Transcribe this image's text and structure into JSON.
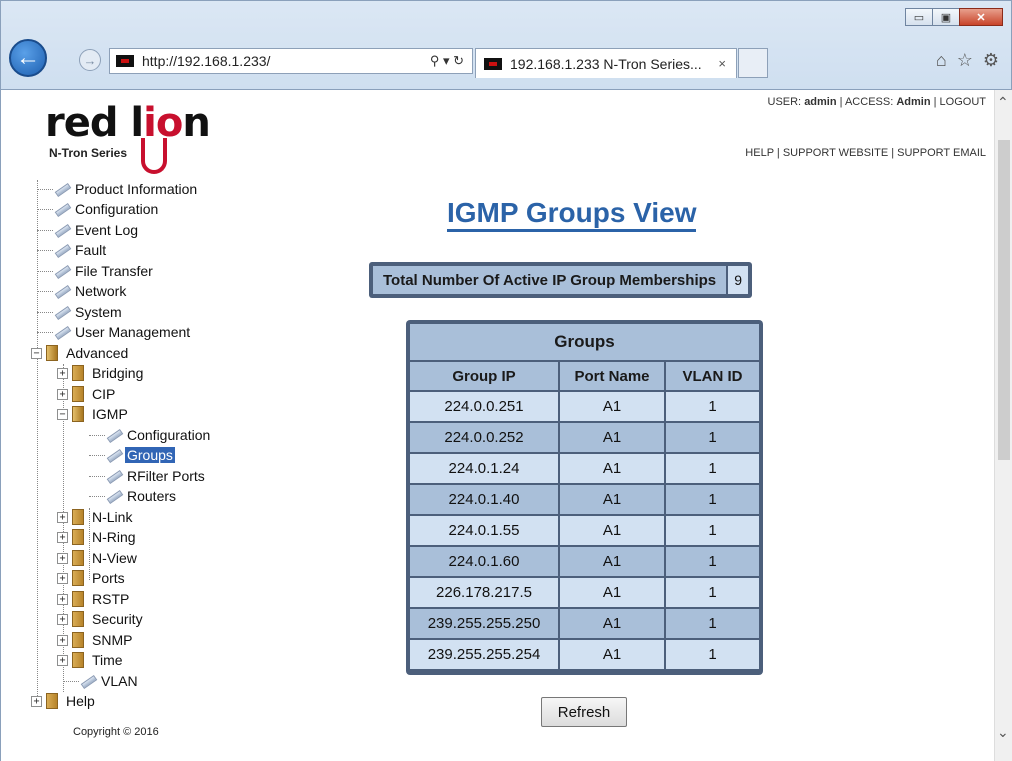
{
  "browser": {
    "url": "http://192.168.1.233/",
    "tab_title": "192.168.1.233 N-Tron Series...",
    "tab_close": "×",
    "back_glyph": "←",
    "forward_glyph": "→",
    "addr_icons": "⚲ ▾ ↻",
    "tools": {
      "home": "⌂",
      "favorites": "☆",
      "settings": "⚙"
    },
    "window": {
      "minimize": "▭",
      "maximize": "▣",
      "close": "✕"
    }
  },
  "header": {
    "logo_text_1": "red l",
    "logo_text_2": "io",
    "logo_text_3": "n",
    "logo_subtitle": "N-Tron Series",
    "user_label": "USER:",
    "user": "admin",
    "access_label": "ACCESS:",
    "access": "Admin",
    "logout": "LOGOUT",
    "help": "HELP",
    "support_website": "SUPPORT WEBSITE",
    "support_email": "SUPPORT EMAIL",
    "sep": "|"
  },
  "tree": {
    "product_information": "Product Information",
    "configuration": "Configuration",
    "event_log": "Event Log",
    "fault": "Fault",
    "file_transfer": "File Transfer",
    "network": "Network",
    "system": "System",
    "user_management": "User Management",
    "advanced": "Advanced",
    "bridging": "Bridging",
    "cip": "CIP",
    "igmp": "IGMP",
    "igmp_configuration": "Configuration",
    "igmp_groups": "Groups",
    "igmp_rfilter": "RFilter Ports",
    "igmp_routers": "Routers",
    "nlink": "N-Link",
    "nring": "N-Ring",
    "nview": "N-View",
    "ports": "Ports",
    "rstp": "RSTP",
    "security": "Security",
    "snmp": "SNMP",
    "time": "Time",
    "vlan": "VLAN",
    "help": "Help",
    "plus": "+",
    "minus": "−"
  },
  "copyright": "Copyright © 2016",
  "main": {
    "title": "IGMP Groups View",
    "total_label": "Total Number Of Active IP Group Memberships",
    "total_value": "9",
    "groups_title": "Groups",
    "columns": [
      "Group IP",
      "Port Name",
      "VLAN ID"
    ],
    "rows": [
      [
        "224.0.0.251",
        "A1",
        "1"
      ],
      [
        "224.0.0.252",
        "A1",
        "1"
      ],
      [
        "224.0.1.24",
        "A1",
        "1"
      ],
      [
        "224.0.1.40",
        "A1",
        "1"
      ],
      [
        "224.0.1.55",
        "A1",
        "1"
      ],
      [
        "224.0.1.60",
        "A1",
        "1"
      ],
      [
        "226.178.217.5",
        "A1",
        "1"
      ],
      [
        "239.255.255.250",
        "A1",
        "1"
      ],
      [
        "239.255.255.254",
        "A1",
        "1"
      ]
    ],
    "refresh": "Refresh"
  },
  "scrollbar": {
    "up": "⌃",
    "down": "⌄"
  }
}
